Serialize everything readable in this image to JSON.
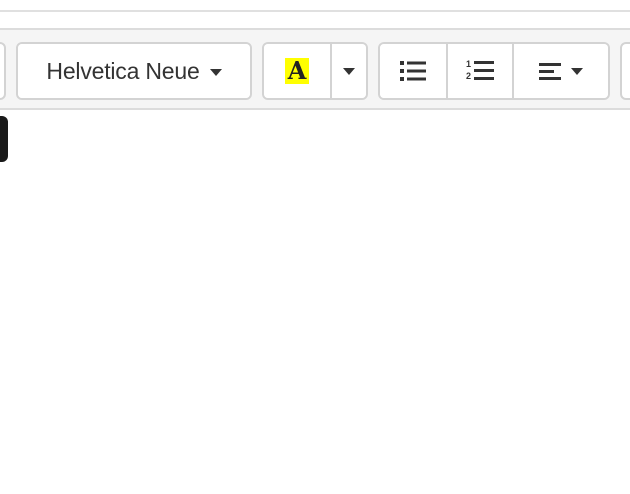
{
  "toolbar": {
    "font_family": {
      "label": "Helvetica Neue",
      "icon": "chevron-down-icon"
    },
    "highlight_color": {
      "glyph": "A",
      "swatch": "#ffff00",
      "icon": "text-highlight-icon",
      "dropdown_icon": "chevron-down-icon"
    },
    "unordered_list": {
      "icon": "unordered-list-icon"
    },
    "ordered_list": {
      "icon": "ordered-list-icon",
      "digits": [
        "1",
        "2"
      ]
    },
    "paragraph_align": {
      "icon": "align-left-icon",
      "dropdown_icon": "chevron-down-icon"
    }
  },
  "colors": {
    "toolbar_bg": "#f5f5f5",
    "button_border": "#d3d3d3",
    "icon": "#333333",
    "tooltip_bg": "#1a1a1a"
  }
}
